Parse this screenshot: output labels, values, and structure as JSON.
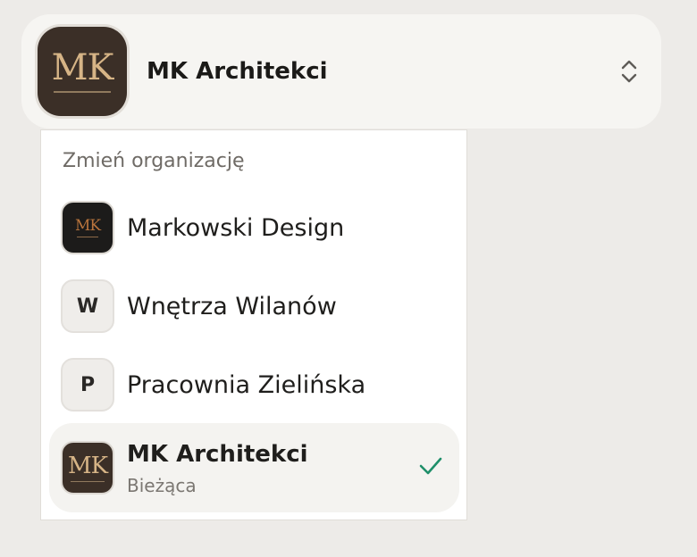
{
  "switcher": {
    "org_name": "MK Architekci",
    "logo_text": "MK"
  },
  "dropdown": {
    "title": "Zmień organizację",
    "items": [
      {
        "label": "Markowski Design",
        "avatar": "MK"
      },
      {
        "label": "Wnętrza Wilanów",
        "avatar": "W"
      },
      {
        "label": "Pracownia Zielińska",
        "avatar": "P"
      }
    ],
    "current": {
      "label": "MK Architekci",
      "avatar": "MK",
      "status": "Bieżąca"
    }
  },
  "colors": {
    "accent_check": "#1f8f6a",
    "logo_bg": "#3b2f27",
    "logo_gold": "#d6b486"
  }
}
